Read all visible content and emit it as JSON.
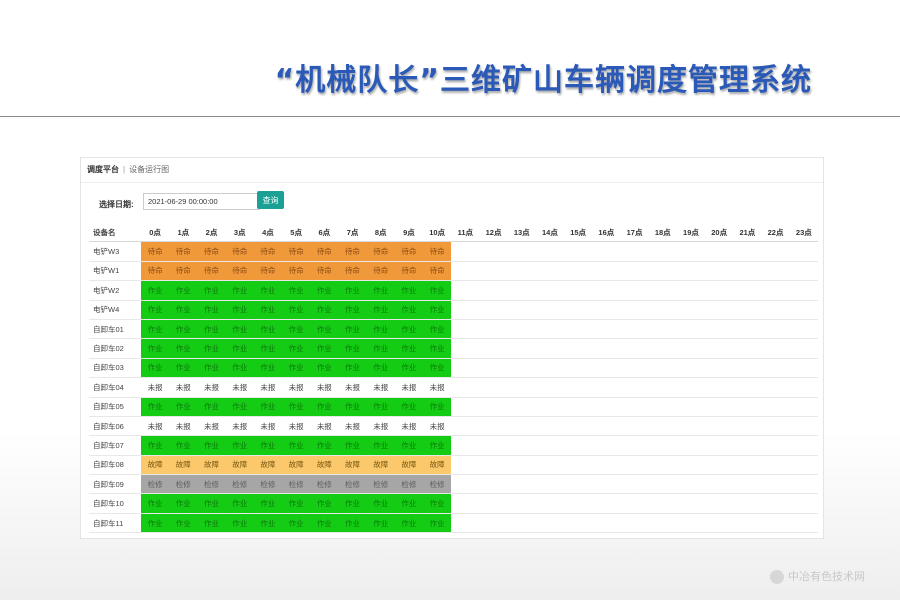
{
  "header": {
    "title": "“机械队长”三维矿山车辆调度管理系统"
  },
  "breadcrumb": {
    "items": [
      "调度平台",
      "设备运行图"
    ],
    "separator": "|"
  },
  "filter": {
    "date_label": "选择日期:",
    "date_value": "2021-06-29 00:00:00",
    "query_label": "查询"
  },
  "table": {
    "name_header": "设备名",
    "hours": [
      "0点",
      "1点",
      "2点",
      "3点",
      "4点",
      "5点",
      "6点",
      "7点",
      "8点",
      "9点",
      "10点",
      "11点",
      "12点",
      "13点",
      "14点",
      "15点",
      "16点",
      "17点",
      "18点",
      "19点",
      "20点",
      "21点",
      "22点",
      "23点"
    ],
    "status_colors": {
      "待命": "#f0993a",
      "作业": "#15cc15",
      "故障": "#fbc86b",
      "检修": "#a6a6a6",
      "未报": "#ffffff"
    },
    "rows": [
      {
        "name": "电铲W3",
        "status": "待命",
        "hours_filled": 11
      },
      {
        "name": "电铲W1",
        "status": "待命",
        "hours_filled": 11
      },
      {
        "name": "电铲W2",
        "status": "作业",
        "hours_filled": 11
      },
      {
        "name": "电铲W4",
        "status": "作业",
        "hours_filled": 11
      },
      {
        "name": "自卸车01",
        "status": "作业",
        "hours_filled": 11
      },
      {
        "name": "自卸车02",
        "status": "作业",
        "hours_filled": 11
      },
      {
        "name": "自卸车03",
        "status": "作业",
        "hours_filled": 11
      },
      {
        "name": "自卸车04",
        "status": "未报",
        "hours_filled": 11
      },
      {
        "name": "自卸车05",
        "status": "作业",
        "hours_filled": 11
      },
      {
        "name": "自卸车06",
        "status": "未报",
        "hours_filled": 11
      },
      {
        "name": "自卸车07",
        "status": "作业",
        "hours_filled": 11
      },
      {
        "name": "自卸车08",
        "status": "故障",
        "hours_filled": 11
      },
      {
        "name": "自卸车09",
        "status": "检修",
        "hours_filled": 11
      },
      {
        "name": "自卸车10",
        "status": "作业",
        "hours_filled": 11
      },
      {
        "name": "自卸车11",
        "status": "作业",
        "hours_filled": 11
      }
    ]
  },
  "watermark": {
    "text": "中冶有色技术网"
  }
}
